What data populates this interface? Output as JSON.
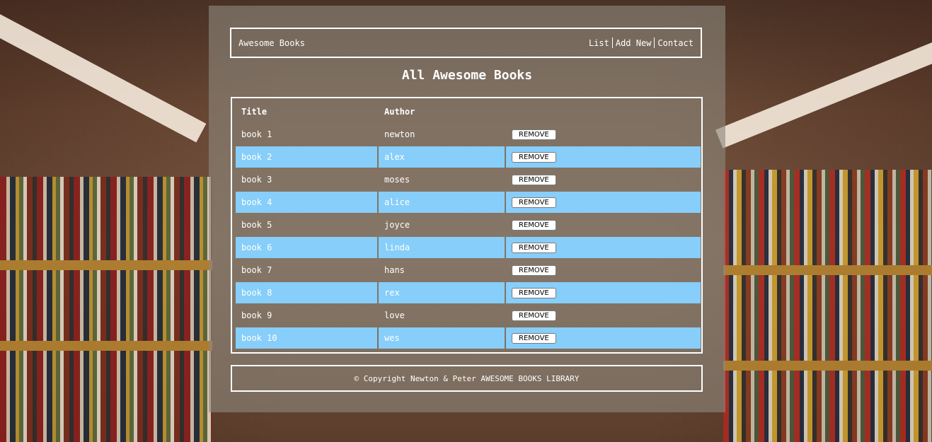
{
  "navbar": {
    "brand": "Awesome Books",
    "links": [
      "List",
      "Add New",
      "Contact"
    ]
  },
  "main": {
    "heading": "All Awesome Books",
    "table": {
      "columns": [
        "Title",
        "Author",
        ""
      ],
      "rows": [
        {
          "title": "book 1",
          "author": "newton",
          "action": "REMOVE"
        },
        {
          "title": "book 2",
          "author": "alex",
          "action": "REMOVE"
        },
        {
          "title": "book 3",
          "author": "moses",
          "action": "REMOVE"
        },
        {
          "title": "book 4",
          "author": "alice",
          "action": "REMOVE"
        },
        {
          "title": "book 5",
          "author": "joyce",
          "action": "REMOVE"
        },
        {
          "title": "book 6",
          "author": "linda",
          "action": "REMOVE"
        },
        {
          "title": "book 7",
          "author": "hans",
          "action": "REMOVE"
        },
        {
          "title": "book 8",
          "author": "rex",
          "action": "REMOVE"
        },
        {
          "title": "book 9",
          "author": "love",
          "action": "REMOVE"
        },
        {
          "title": "book 10",
          "author": "wes",
          "action": "REMOVE"
        }
      ]
    }
  },
  "footer": {
    "text": "© Copyright Newton & Peter AWESOME BOOKS LIBRARY"
  },
  "colors": {
    "row_highlight": "#87cefa",
    "border": "#ffffff",
    "panel": "rgba(140,135,125,0.62)"
  }
}
